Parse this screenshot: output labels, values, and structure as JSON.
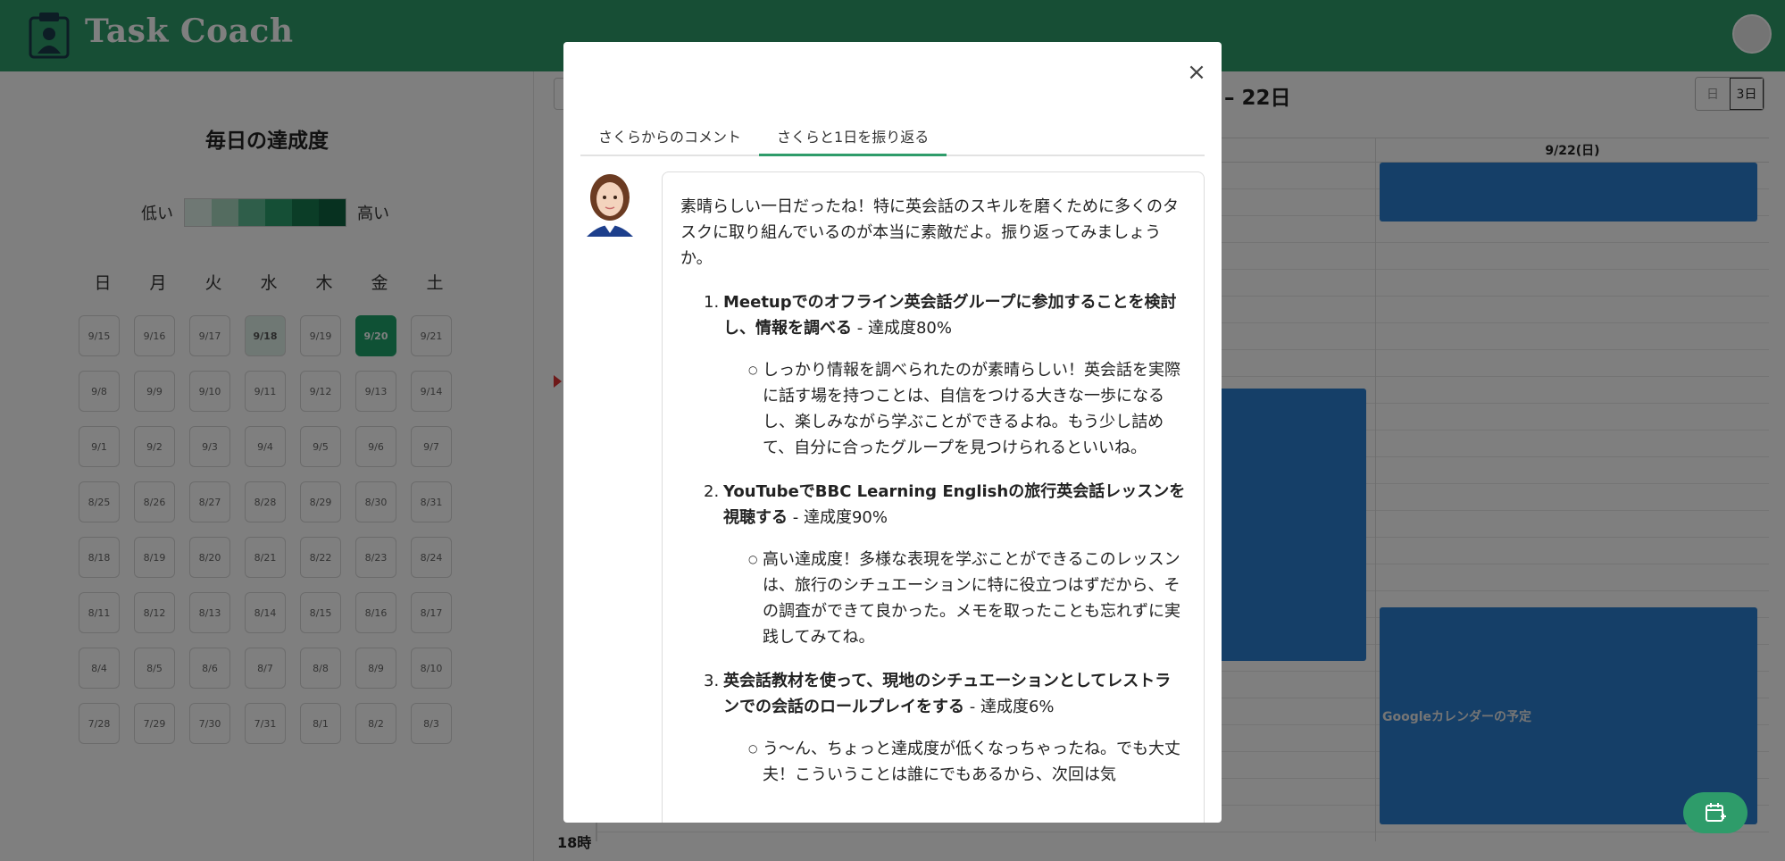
{
  "app": {
    "title": "Task Coach"
  },
  "left_panel": {
    "title": "毎日の達成度",
    "legend_low": "低い",
    "legend_high": "高い",
    "legend_colors": [
      "#dff1e8",
      "#a8d9c0",
      "#5ebd94",
      "#2a9f6c",
      "#177a4f",
      "#0e6340"
    ],
    "weekdays": [
      "日",
      "月",
      "火",
      "水",
      "木",
      "金",
      "土"
    ],
    "weeks": [
      [
        "9/15",
        "9/16",
        "9/17",
        "9/18",
        "9/19",
        "9/20",
        "9/21"
      ],
      [
        "9/8",
        "9/9",
        "9/10",
        "9/11",
        "9/12",
        "9/13",
        "9/14"
      ],
      [
        "9/1",
        "9/2",
        "9/3",
        "9/4",
        "9/5",
        "9/6",
        "9/7"
      ],
      [
        "8/25",
        "8/26",
        "8/27",
        "8/28",
        "8/29",
        "8/30",
        "8/31"
      ],
      [
        "8/18",
        "8/19",
        "8/20",
        "8/21",
        "8/22",
        "8/23",
        "8/24"
      ],
      [
        "8/11",
        "8/12",
        "8/13",
        "8/14",
        "8/15",
        "8/16",
        "8/17"
      ],
      [
        "8/4",
        "8/5",
        "8/6",
        "8/7",
        "8/8",
        "8/9",
        "8/10"
      ],
      [
        "7/28",
        "7/29",
        "7/30",
        "7/31",
        "8/1",
        "8/2",
        "8/3"
      ]
    ],
    "highlight": {
      "9/18": "low",
      "9/20": "high"
    }
  },
  "calendar": {
    "range_title": "日 – 22日",
    "view_day": "日",
    "view_3day": "3日",
    "day_header": "9/22(日)",
    "time_label": "18時",
    "event_label": "Googleカレンダーの予定",
    "colors": {
      "event": "#2b7fd0"
    }
  },
  "modal": {
    "tab_comment": "さくらからのコメント",
    "tab_review": "さくらと1日を振り返る",
    "intro": "素晴らしい一日だったね！特に英会話のスキルを磨くために多くのタスクに取り組んでいるのが本当に素敵だよ。振り返ってみましょうか。",
    "items": [
      {
        "num": "1.",
        "title": "Meetupでのオフライン英会話グループに参加することを検討し、情報を調べる",
        "rate": " - 達成度80%",
        "comment": "しっかり情報を調べられたのが素晴らしい！英会話を実際に話す場を持つことは、自信をつける大きな一歩になるし、楽しみながら学ぶことができるよね。もう少し詰めて、自分に合ったグループを見つけられるといいね。"
      },
      {
        "num": "2.",
        "title": "YouTubeでBBC Learning Englishの旅行英会話レッスンを視聴する",
        "rate": " - 達成度90%",
        "comment": "高い達成度！多様な表現を学ぶことができるこのレッスンは、旅行のシチュエーションに特に役立つはずだから、その調査ができて良かった。メモを取ったことも忘れずに実践してみてね。"
      },
      {
        "num": "3.",
        "title": "英会話教材を使って、現地のシチュエーションとしてレストランでの会話のロールプレイをする",
        "rate": " - 達成度6%",
        "comment": "う〜ん、ちょっと達成度が低くなっちゃったね。でも大丈夫！こういうことは誰にでもあるから、次回は気"
      }
    ]
  },
  "colors": {
    "brand": "#2e9c6a"
  }
}
